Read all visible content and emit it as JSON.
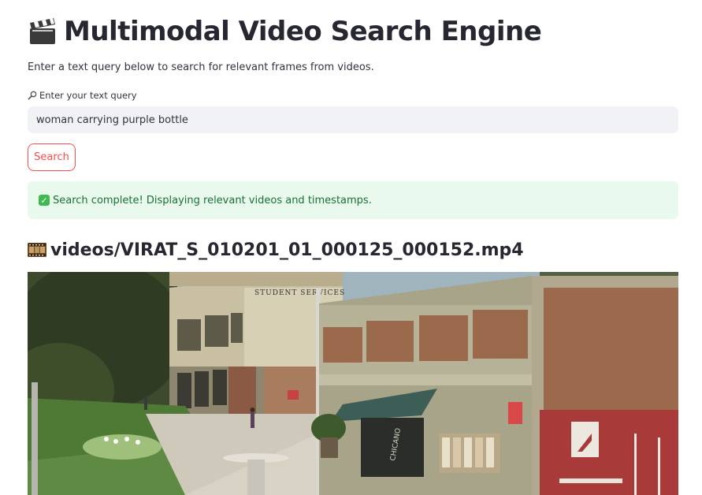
{
  "header": {
    "title": "Multimodal Video Search Engine",
    "icon": "clapperboard-icon"
  },
  "intro": {
    "text": "Enter a text query below to search for relevant frames from videos."
  },
  "search": {
    "label": "Enter your text query",
    "label_icon": "magnifier-icon",
    "value": "woman carrying purple bottle",
    "button_label": "Search"
  },
  "status": {
    "message": "Search complete! Displaying relevant videos and timestamps.",
    "icon": "check-icon"
  },
  "result": {
    "icon": "film-frames-icon",
    "video_path": "videos/VIRAT_S_010201_01_000125_000152.mp4",
    "sign_text": "STUDENT SERVICES",
    "awning_text": "CHICANO"
  },
  "colors": {
    "accent": "#ff4b4b",
    "success_bg": "#e9f9ee",
    "success_text": "#177233",
    "input_bg": "#f0f2f6"
  }
}
